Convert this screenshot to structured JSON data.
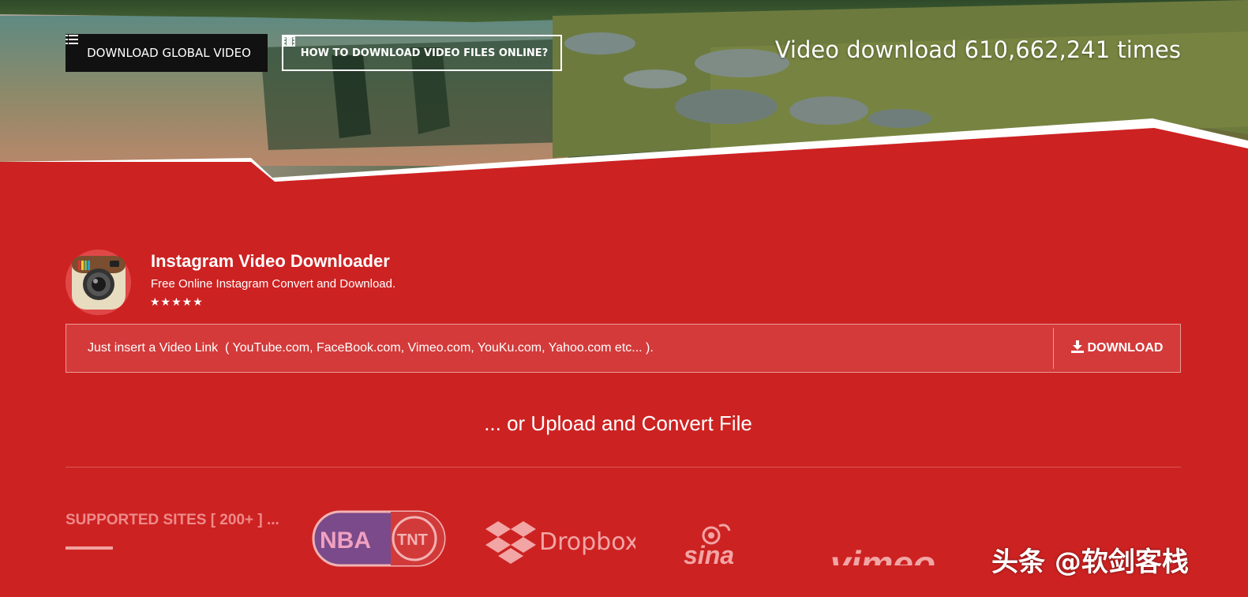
{
  "header": {
    "download_global_video_label": "DOWNLOAD GLOBAL VIDEO",
    "how_to_label": "HOW TO DOWNLOAD VIDEO FILES ONLINE?",
    "counter_text": "Video download 610,662,241 times"
  },
  "app": {
    "title": "Instagram Video Downloader",
    "subtitle": "Free Online Instagram Convert and Download.",
    "stars": "★★★★★",
    "rating": 5
  },
  "search": {
    "placeholder": "Just insert a Video Link  ( YouTube.com, FaceBook.com, Vimeo.com, YouKu.com, Yahoo.com etc... ).",
    "value": "",
    "download_label": "DOWNLOAD"
  },
  "upload": {
    "label": "... or Upload and Convert File"
  },
  "supported": {
    "label": "SUPPORTED SITES [ 200+ ] ...",
    "logos": [
      {
        "name": "NBA",
        "second": "TNT"
      },
      {
        "name": "Dropbox"
      },
      {
        "name": "sina"
      },
      {
        "name": "vimeo"
      }
    ]
  },
  "watermark": {
    "text": "头条 @软剑客栈"
  },
  "colors": {
    "brand_red": "#cd2222",
    "input_bg": "#d43a3a",
    "supported_text": "#ef8a8a"
  }
}
